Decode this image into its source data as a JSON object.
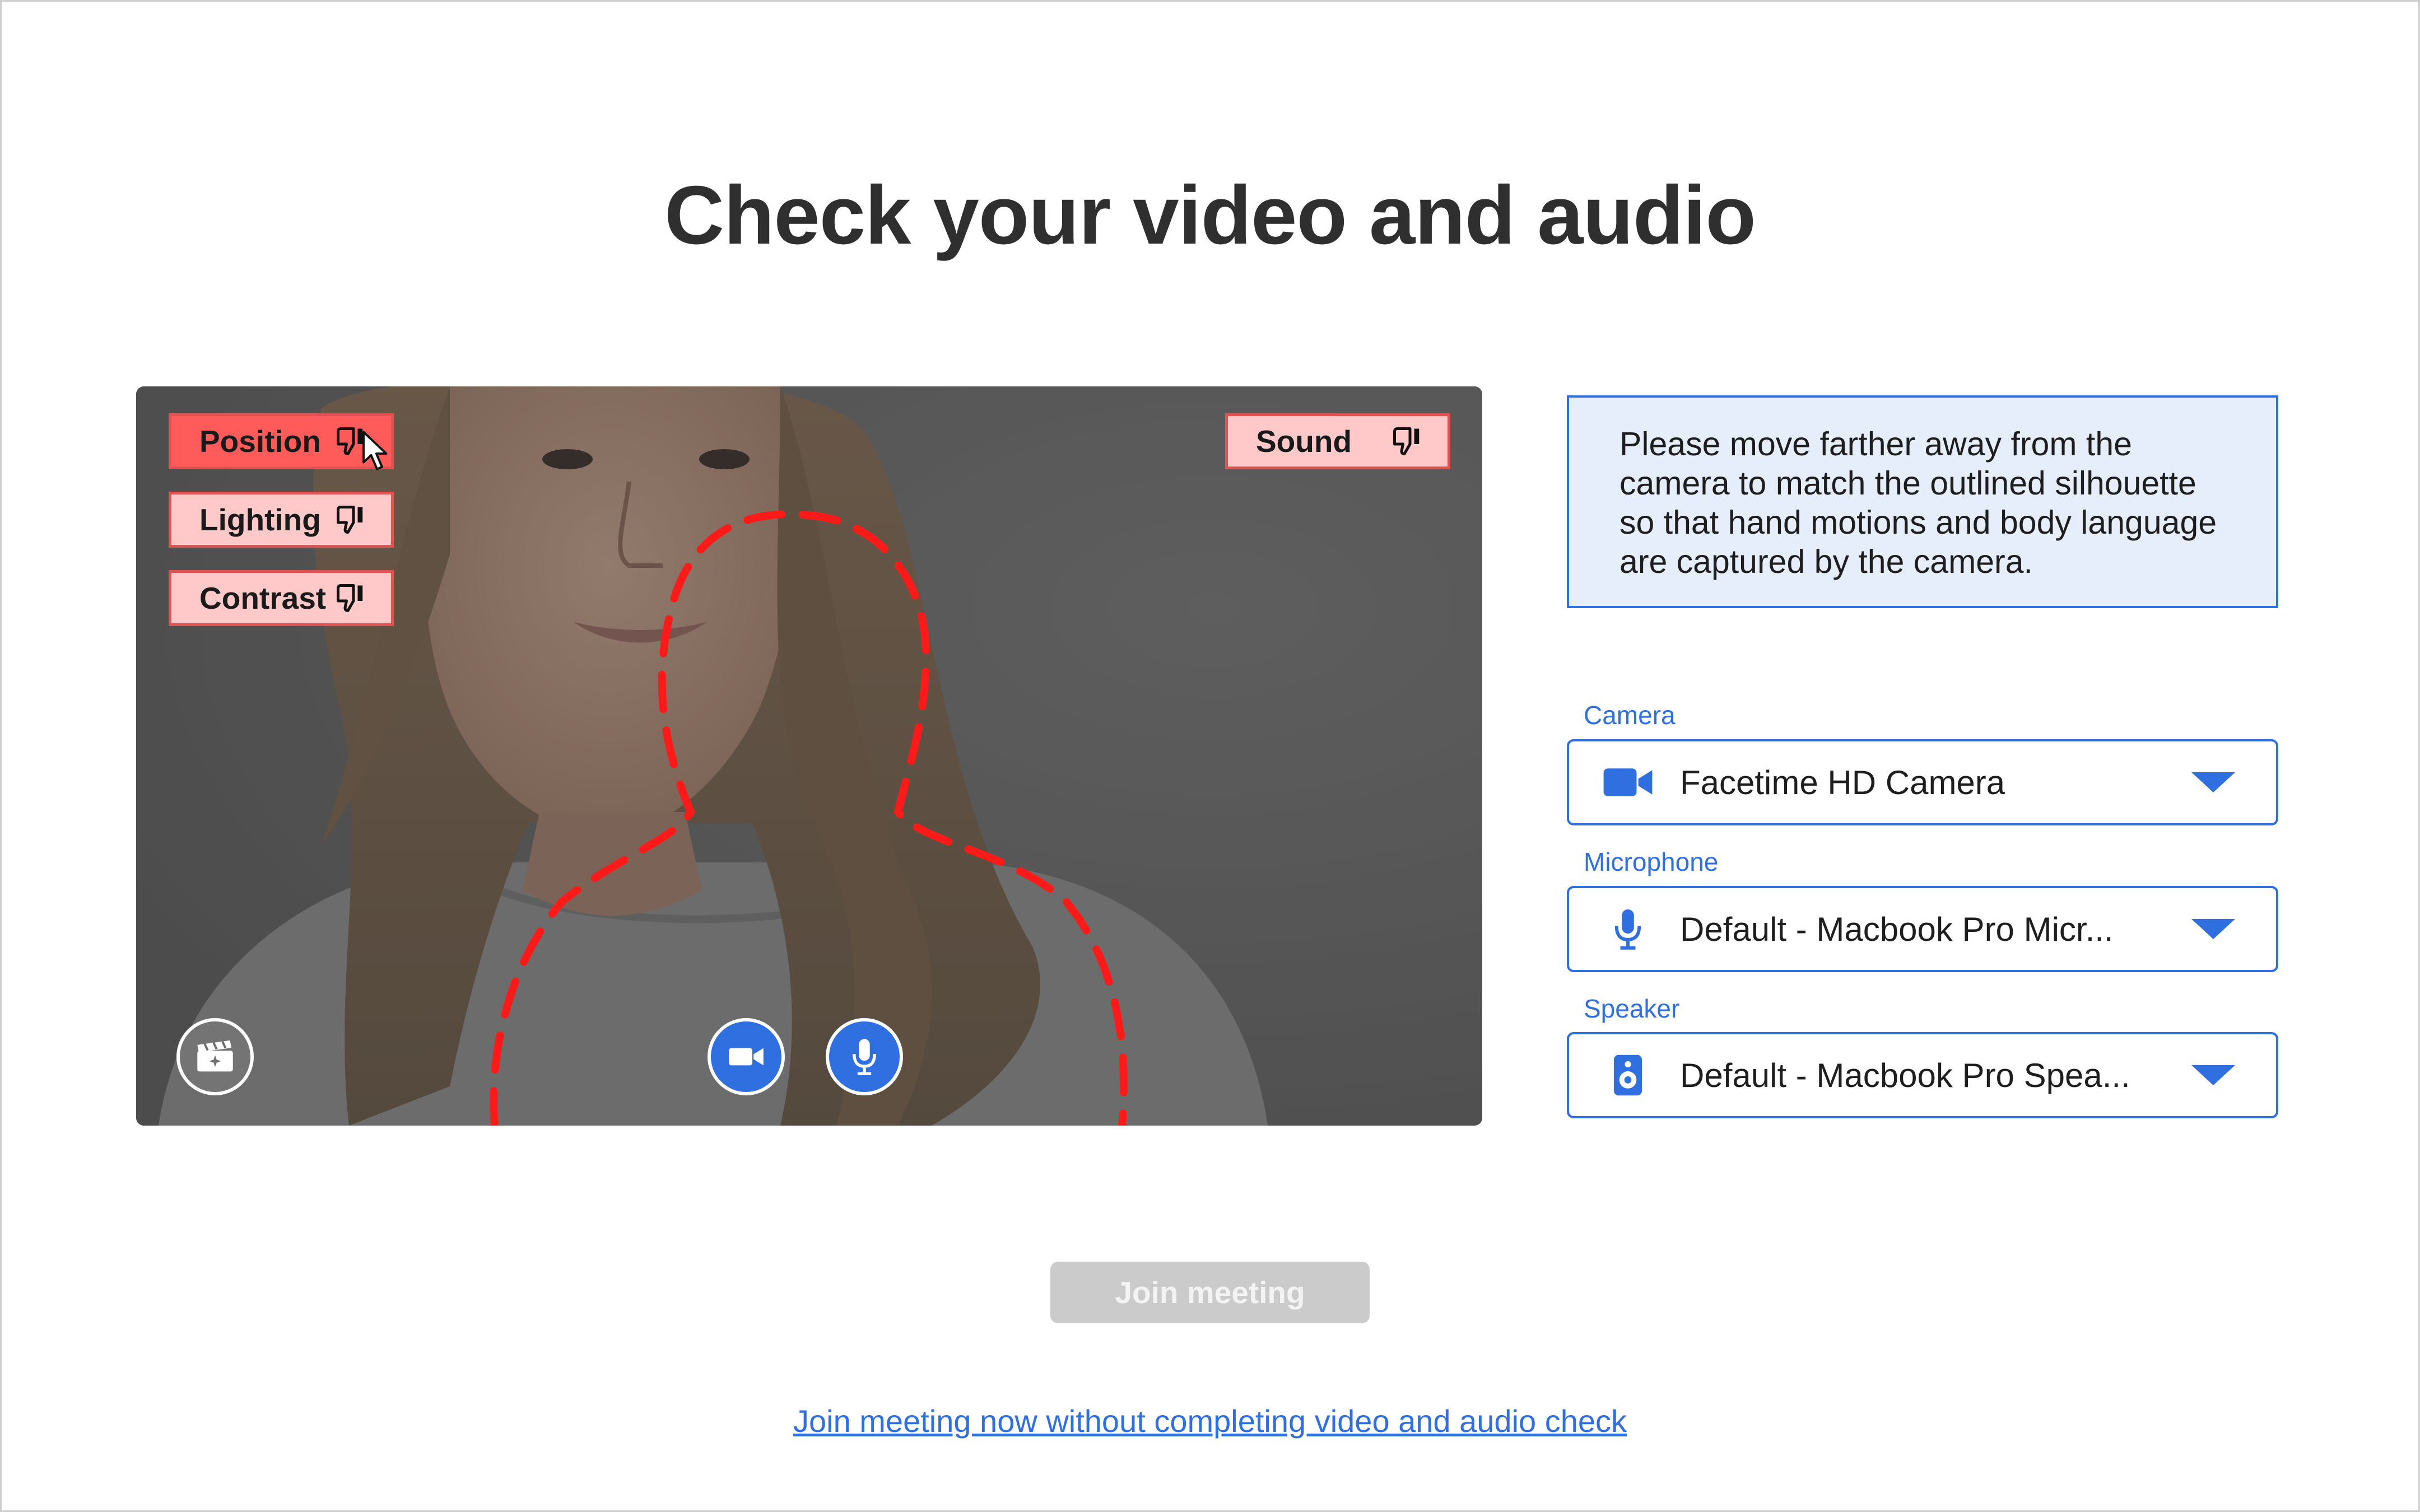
{
  "page": {
    "title": "Check your video and audio",
    "accent_color": "#2f6fe0",
    "alert_color": "#e35252"
  },
  "preview": {
    "checks": [
      {
        "label": "Position",
        "status": "thumbs-down",
        "active": true
      },
      {
        "label": "Lighting",
        "status": "thumbs-down",
        "active": false
      },
      {
        "label": "Contrast",
        "status": "thumbs-down",
        "active": false
      },
      {
        "label": "Sound",
        "status": "thumbs-down",
        "active": false
      }
    ],
    "controls": [
      {
        "name": "effects",
        "icon": "clapperboard-sparkle-icon"
      },
      {
        "name": "camera",
        "icon": "video-camera-icon"
      },
      {
        "name": "microphone",
        "icon": "microphone-icon"
      }
    ],
    "silhouette_color": "#ff1a1a"
  },
  "guidance": {
    "message": "Please move farther away from the camera to match the outlined silhouette so that hand motions and body language are captured by the camera."
  },
  "devices": {
    "camera": {
      "label": "Camera",
      "value": "Facetime HD Camera",
      "icon": "video-camera-icon"
    },
    "microphone": {
      "label": "Microphone",
      "value": "Default - Macbook Pro Micr...",
      "icon": "microphone-icon"
    },
    "speaker": {
      "label": "Speaker",
      "value": "Default - Macbook Pro Spea...",
      "icon": "speaker-icon"
    }
  },
  "actions": {
    "join_label": "Join meeting",
    "join_disabled": true,
    "skip_link": "Join meeting now without completing video and audio check"
  }
}
